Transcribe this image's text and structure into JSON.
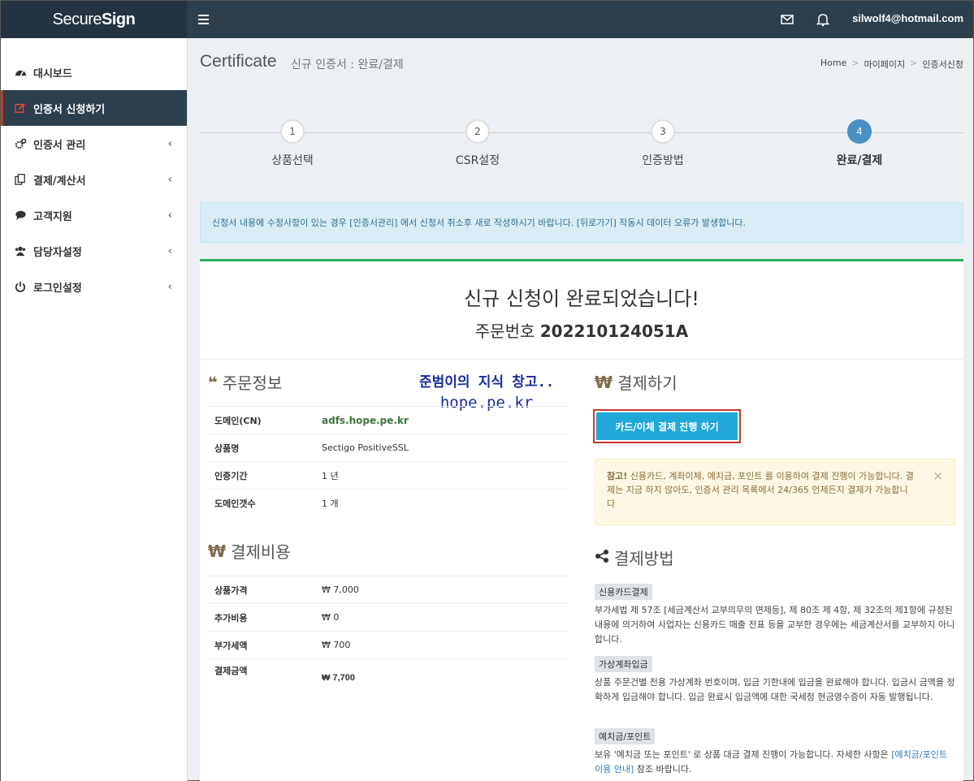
{
  "header": {
    "logo_a": "Secure",
    "logo_b": "Sign",
    "user_email": "silwolf4@hotmail.com"
  },
  "sidebar": {
    "items": [
      {
        "label": "대시보드",
        "icon": "dashboard-icon",
        "active": false,
        "chevron": false
      },
      {
        "label": "인증서 신청하기",
        "icon": "edit-icon",
        "active": true,
        "chevron": false
      },
      {
        "label": "인증서 관리",
        "icon": "cogs-icon",
        "active": false,
        "chevron": true
      },
      {
        "label": "결제/계산서",
        "icon": "copy-icon",
        "active": false,
        "chevron": true
      },
      {
        "label": "고객지원",
        "icon": "comments-icon",
        "active": false,
        "chevron": true
      },
      {
        "label": "담당자설정",
        "icon": "users-icon",
        "active": false,
        "chevron": true
      },
      {
        "label": "로그인설정",
        "icon": "power-icon",
        "active": false,
        "chevron": true
      }
    ]
  },
  "page": {
    "title": "Certificate",
    "subtitle": "신규 인증서 : 완료/결제",
    "breadcrumb": [
      "Home",
      "마이페이지",
      "인증서신청"
    ]
  },
  "steps": [
    {
      "num": "1",
      "label": "상품선택"
    },
    {
      "num": "2",
      "label": "CSR설정"
    },
    {
      "num": "3",
      "label": "인증방법"
    },
    {
      "num": "4",
      "label": "완료/결제"
    }
  ],
  "alert": "신청서 내용에 수정사항이 있는 경우 [인증서관리] 에서 신청서 취소후 새로 작성하시기 바랍니다. [뒤로가기] 작동시 데이터 오류가 발생합니다.",
  "complete": {
    "title": "신규 신청이 완료되었습니다!",
    "order_label": "주문번호",
    "order_no": "202210124051A"
  },
  "order_info": {
    "heading": "주문정보",
    "rows": [
      {
        "k": "도메인(CN)",
        "v": "adfs.hope.pe.kr"
      },
      {
        "k": "상품명",
        "v": "Sectigo PositiveSSL"
      },
      {
        "k": "인증기간",
        "v": "1 년"
      },
      {
        "k": "도메인갯수",
        "v": "1 개"
      }
    ]
  },
  "cost": {
    "heading": "결제비용",
    "rows": [
      {
        "k": "상품가격",
        "v": "₩ 7,000"
      },
      {
        "k": "추가비용",
        "v": "₩ 0"
      },
      {
        "k": "부가세액",
        "v": "₩ 700"
      },
      {
        "k": "결제금액",
        "v": "₩ 7,700"
      }
    ]
  },
  "watermark": {
    "line1": "준범이의 지식 창고..",
    "line2": "hope.pe.kr"
  },
  "payment": {
    "heading": "결제하기",
    "button": "카드/이체 결제 진행 하기",
    "note_bold": "참고!",
    "note": " 신용카드, 계좌이체, 예치금, 포인트 를 이용하여 결제 진행이 가능합니다. 결제는 지금 하지 않아도, 인증서 관리 목록에서 24/365 언제든지 결제가 가능합니다",
    "close": "×"
  },
  "methods": {
    "heading": "결제방법",
    "items": [
      {
        "tag": "신용카드결제",
        "text": "부가세법 제 57조 [세금계산서 교부의무의 면제등], 제 80조 제 4항, 제 32조의 제1항에 규정된 내용에 의거하여 사업자는 신용카드 매출 전표 등을 교부한 경우에는 세금계산서를 교부하지 아니합니다."
      },
      {
        "tag": "가상계좌입금",
        "text": "상품 주문건별 전용 가상계좌 번호이며, 입금 기한내에 입금을 완료해야 합니다. 입금시 금액을 정확하게 입금해야 합니다. 입금 완료시 입금액에 대한 국세청 현금영수증이 자동 발행됩니다."
      },
      {
        "tag": "예치금/포인트",
        "text": "보유 '예치금 또는 포인트' 로 상품 대금 결제 진행이 가능합니다. 자세한 사항은 ",
        "link": "[예치금/포인트 이용 안내]",
        "text_after": " 참조 바랍니다."
      }
    ]
  }
}
